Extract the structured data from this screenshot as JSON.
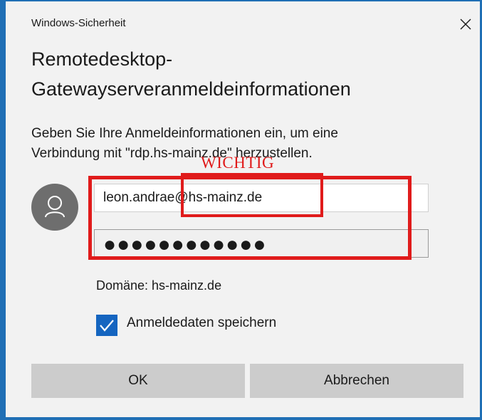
{
  "window": {
    "title": "Windows-Sicherheit",
    "close_icon": "close-icon"
  },
  "dialog": {
    "heading_line1": "Remotedesktop-",
    "heading_line2": "Gatewayserveranmeldeinformationen",
    "description_line1": "Geben Sie Ihre Anmeldeinformationen ein, um eine",
    "description_line2": "Verbindung mit \"rdp.hs-mainz.de\" herzustellen."
  },
  "credentials": {
    "avatar_icon": "user-avatar-icon",
    "username": "leon.andrae@hs-mainz.de",
    "password_masked": "●●●●●●●●●●●●",
    "domain_label": "Domäne: hs-mainz.de",
    "remember_label": "Anmeldedaten speichern",
    "remember_checked": true
  },
  "annotation": {
    "text": "WICHTIG",
    "color": "#e01b1b"
  },
  "buttons": {
    "ok_label": "OK",
    "cancel_label": "Abbrechen"
  },
  "colors": {
    "accent": "#1565c0",
    "window_border": "#1f6fb5",
    "dialog_background": "#f2f2f2",
    "button_background": "#cccccc",
    "avatar_background": "#6e6e6e"
  }
}
